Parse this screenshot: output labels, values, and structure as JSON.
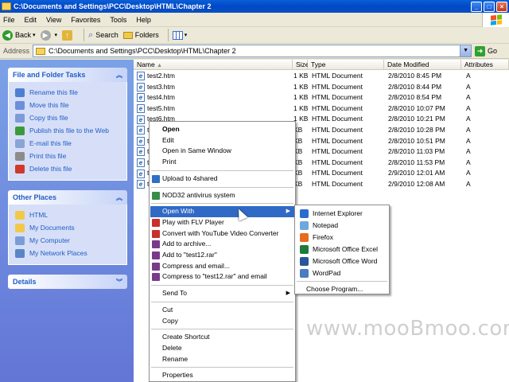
{
  "window": {
    "title": "C:\\Documents and Settings\\PCC\\Desktop\\HTML\\Chapter 2",
    "controls": [
      "_",
      "□",
      "×"
    ]
  },
  "menubar": [
    "File",
    "Edit",
    "View",
    "Favorites",
    "Tools",
    "Help"
  ],
  "toolbar": {
    "back": "Back",
    "search": "Search",
    "folders": "Folders"
  },
  "address": {
    "label": "Address",
    "value": "C:\\Documents and Settings\\PCC\\Desktop\\HTML\\Chapter 2",
    "go": "Go"
  },
  "left_pane": {
    "tasks_title": "File and Folder Tasks",
    "tasks": [
      {
        "label": "Rename this file",
        "icon": "rename-icon",
        "color": "#4f7fd0"
      },
      {
        "label": "Move this file",
        "icon": "move-icon",
        "color": "#6d8fd9"
      },
      {
        "label": "Copy this file",
        "icon": "copy-icon",
        "color": "#7d9bd8"
      },
      {
        "label": "Publish this file to the Web",
        "icon": "globe-icon",
        "color": "#3c9a3c"
      },
      {
        "label": "E-mail this file",
        "icon": "email-icon",
        "color": "#8aa4d6"
      },
      {
        "label": "Print this file",
        "icon": "printer-icon",
        "color": "#8c8c8c"
      },
      {
        "label": "Delete this file",
        "icon": "delete-icon",
        "color": "#d03a2a"
      }
    ],
    "places_title": "Other Places",
    "places": [
      {
        "label": "HTML",
        "icon": "folder-icon",
        "color": "#f1c94a"
      },
      {
        "label": "My Documents",
        "icon": "folder-icon",
        "color": "#f1c94a"
      },
      {
        "label": "My Computer",
        "icon": "computer-icon",
        "color": "#7a9dd8"
      },
      {
        "label": "My Network Places",
        "icon": "network-icon",
        "color": "#5a86c8"
      }
    ],
    "details_title": "Details"
  },
  "columns": {
    "name": "Name",
    "size": "Size",
    "type": "Type",
    "date": "Date Modified",
    "attributes": "Attributes"
  },
  "files": [
    {
      "name": "test2.htm",
      "size": "1 KB",
      "type": "HTML Document",
      "date": "2/8/2010 8:45 PM",
      "attr": "A"
    },
    {
      "name": "test3.htm",
      "size": "1 KB",
      "type": "HTML Document",
      "date": "2/8/2010 8:44 PM",
      "attr": "A"
    },
    {
      "name": "test4.htm",
      "size": "1 KB",
      "type": "HTML Document",
      "date": "2/8/2010 8:54 PM",
      "attr": "A"
    },
    {
      "name": "test5.htm",
      "size": "1 KB",
      "type": "HTML Document",
      "date": "2/8/2010 10:07 PM",
      "attr": "A"
    },
    {
      "name": "test6.htm",
      "size": "1 KB",
      "type": "HTML Document",
      "date": "2/8/2010 10:21 PM",
      "attr": "A"
    },
    {
      "name": "t",
      "size": "KB",
      "type": "HTML Document",
      "date": "2/8/2010 10:28 PM",
      "attr": "A"
    },
    {
      "name": "t",
      "size": "KB",
      "type": "HTML Document",
      "date": "2/8/2010 10:51 PM",
      "attr": "A"
    },
    {
      "name": "t",
      "size": "KB",
      "type": "HTML Document",
      "date": "2/8/2010 11:03 PM",
      "attr": "A"
    },
    {
      "name": "t",
      "size": "KB",
      "type": "HTML Document",
      "date": "2/8/2010 11:53 PM",
      "attr": "A"
    },
    {
      "name": "t",
      "size": "KB",
      "type": "HTML Document",
      "date": "2/9/2010 12:01 AM",
      "attr": "A"
    },
    {
      "name": "t",
      "size": "KB",
      "type": "HTML Document",
      "date": "2/9/2010 12:08 AM",
      "attr": "A"
    }
  ],
  "context_menu": [
    {
      "label": "Open",
      "bold": true
    },
    {
      "label": "Edit"
    },
    {
      "label": "Open in Same Window"
    },
    {
      "label": "Print"
    },
    {
      "sep": true
    },
    {
      "label": "Upload to 4shared",
      "icon": "upload-icon",
      "color": "#2f6fc4"
    },
    {
      "sep": true
    },
    {
      "label": "NOD32 antivirus system",
      "icon": "antivirus-icon",
      "color": "#3a8c4a"
    },
    {
      "sep": true
    },
    {
      "label": "Open With",
      "highlight": true,
      "submenu": true
    },
    {
      "label": "Play with FLV Player",
      "icon": "flv-icon",
      "color": "#c8302c"
    },
    {
      "label": "Convert with YouTube Video Converter",
      "icon": "youtube-icon",
      "color": "#c8302c"
    },
    {
      "label": "Add to archive...",
      "icon": "archive-icon",
      "color": "#7a3a8a"
    },
    {
      "label": "Add to \"test12.rar\"",
      "icon": "archive-icon",
      "color": "#7a3a8a"
    },
    {
      "label": "Compress and email...",
      "icon": "archive-icon",
      "color": "#7a3a8a"
    },
    {
      "label": "Compress to \"test12.rar\" and email",
      "icon": "archive-icon",
      "color": "#7a3a8a"
    },
    {
      "sep": true
    },
    {
      "label": "Send To",
      "submenu": true
    },
    {
      "sep": true
    },
    {
      "label": "Cut"
    },
    {
      "label": "Copy"
    },
    {
      "sep": true
    },
    {
      "label": "Create Shortcut"
    },
    {
      "label": "Delete"
    },
    {
      "label": "Rename"
    },
    {
      "sep": true
    },
    {
      "label": "Properties"
    }
  ],
  "open_with_menu": [
    {
      "label": "Internet Explorer",
      "icon": "ie-icon",
      "color": "#2a6bd0"
    },
    {
      "label": "Notepad",
      "icon": "notepad-icon",
      "color": "#6fa8dc"
    },
    {
      "label": "Firefox",
      "icon": "firefox-icon",
      "color": "#e76b1c"
    },
    {
      "label": "Microsoft Office Excel",
      "icon": "excel-icon",
      "color": "#1d7a3a"
    },
    {
      "label": "Microsoft Office Word",
      "icon": "word-icon",
      "color": "#2a5699"
    },
    {
      "label": "WordPad",
      "icon": "wordpad-icon",
      "color": "#4a7cc0"
    },
    {
      "sep": true
    },
    {
      "label": "Choose Program..."
    }
  ],
  "watermark": "www.mooBmoo.com"
}
